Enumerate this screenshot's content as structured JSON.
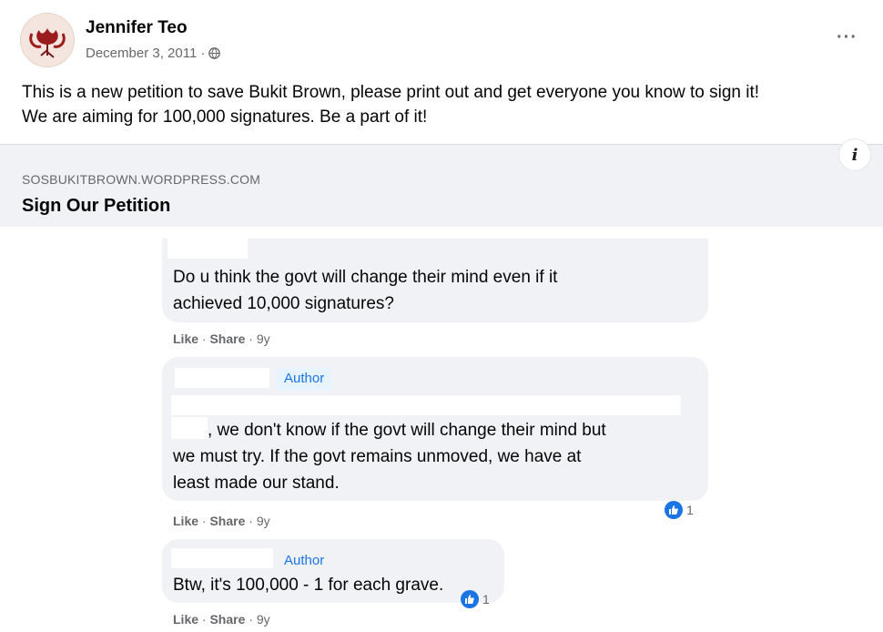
{
  "post": {
    "author": "Jennifer Teo",
    "date": "December 3, 2011 ·",
    "more_label": "···",
    "text_line1": "This is a new petition to save Bukit Brown, please print out and get everyone you know to sign it!",
    "text_line2": "We are aiming for 100,000 signatures. Be a part of it!"
  },
  "link": {
    "domain": "SOSBUKITBROWN.WORDPRESS.COM",
    "title": "Sign Our Petition",
    "info_icon": "i"
  },
  "comments": [
    {
      "line1": "Do u think the govt will change their mind even if it",
      "line2": "achieved 10,000 signatures?",
      "like": "Like",
      "share": "Share",
      "time": "9y"
    },
    {
      "badge": "Author",
      "line1": ", we don't know if the govt will change their mind but",
      "line2": "we must try. If the govt remains unmoved, we have at",
      "line3": "least made our stand.",
      "reactions": "1",
      "like": "Like",
      "share": "Share",
      "time": "9y"
    },
    {
      "badge": "Author",
      "line1": "Btw, it's 100,000 - 1 for each grave.",
      "reactions": "1",
      "like": "Like",
      "share": "Share",
      "time": "9y"
    }
  ],
  "colors": {
    "accent": "#1b74e4",
    "bubble": "#f0f2f5",
    "meta": "#65676b"
  },
  "icons": [
    "globe-icon",
    "more-icon",
    "info-icon",
    "like-reaction-icon"
  ]
}
